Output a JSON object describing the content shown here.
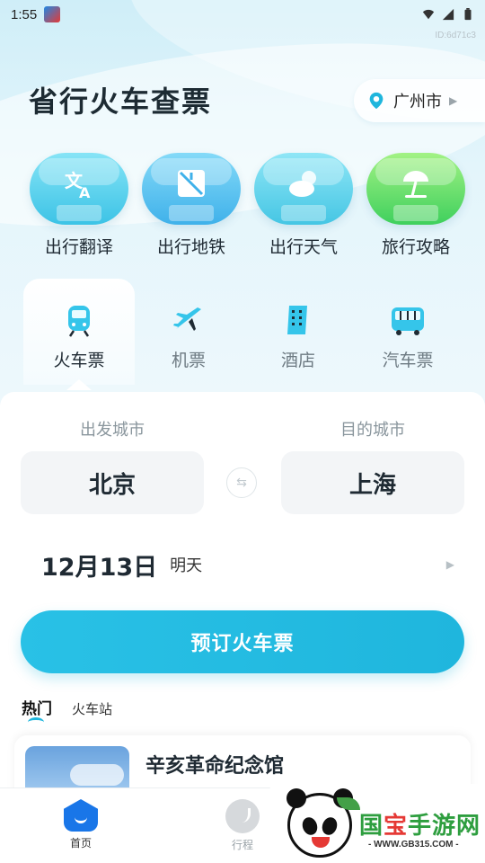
{
  "status_bar": {
    "time": "1:55",
    "device_id": "ID:6d71c3"
  },
  "header": {
    "title": "省行火车查票",
    "city": "广州市"
  },
  "tools": [
    {
      "label": "出行翻译",
      "icon": "translate-icon",
      "color_top": "#7fe0f5",
      "color_bottom": "#3cc3e6"
    },
    {
      "label": "出行地铁",
      "icon": "metro-map-icon",
      "color_top": "#7fd5f7",
      "color_bottom": "#3fb1ea"
    },
    {
      "label": "出行天气",
      "icon": "weather-cloud-icon",
      "color_top": "#8ae3f4",
      "color_bottom": "#45c6e4"
    },
    {
      "label": "旅行攻略",
      "icon": "beach-umbrella-icon",
      "color_top": "#9af07c",
      "color_bottom": "#3fd05d"
    }
  ],
  "transport_tabs": [
    {
      "label": "火车票",
      "icon": "train-icon",
      "active": true
    },
    {
      "label": "机票",
      "icon": "plane-icon",
      "active": false
    },
    {
      "label": "酒店",
      "icon": "hotel-icon",
      "active": false
    },
    {
      "label": "汽车票",
      "icon": "bus-icon",
      "active": false
    }
  ],
  "booking": {
    "from_caption": "出发城市",
    "to_caption": "目的城市",
    "from_city": "北京",
    "to_city": "上海",
    "date": "12月13日",
    "date_hint": "明天",
    "submit_label": "预订火车票"
  },
  "hot_tabs": [
    {
      "label": "热门",
      "active": true
    },
    {
      "label": "火车站",
      "active": false
    }
  ],
  "attraction": {
    "name": "辛亥革命纪念馆"
  },
  "bottom_nav": [
    {
      "label": "首页",
      "icon": "home-icon",
      "active": true
    },
    {
      "label": "行程",
      "icon": "trip-icon",
      "active": false
    }
  ],
  "watermark": {
    "brand_green": "国",
    "brand_red": "宝",
    "brand_rest": "手游网",
    "url": "- WWW.GB315.COM -"
  },
  "colors": {
    "accent": "#1fb6dd",
    "nav_active": "#1976e8"
  }
}
